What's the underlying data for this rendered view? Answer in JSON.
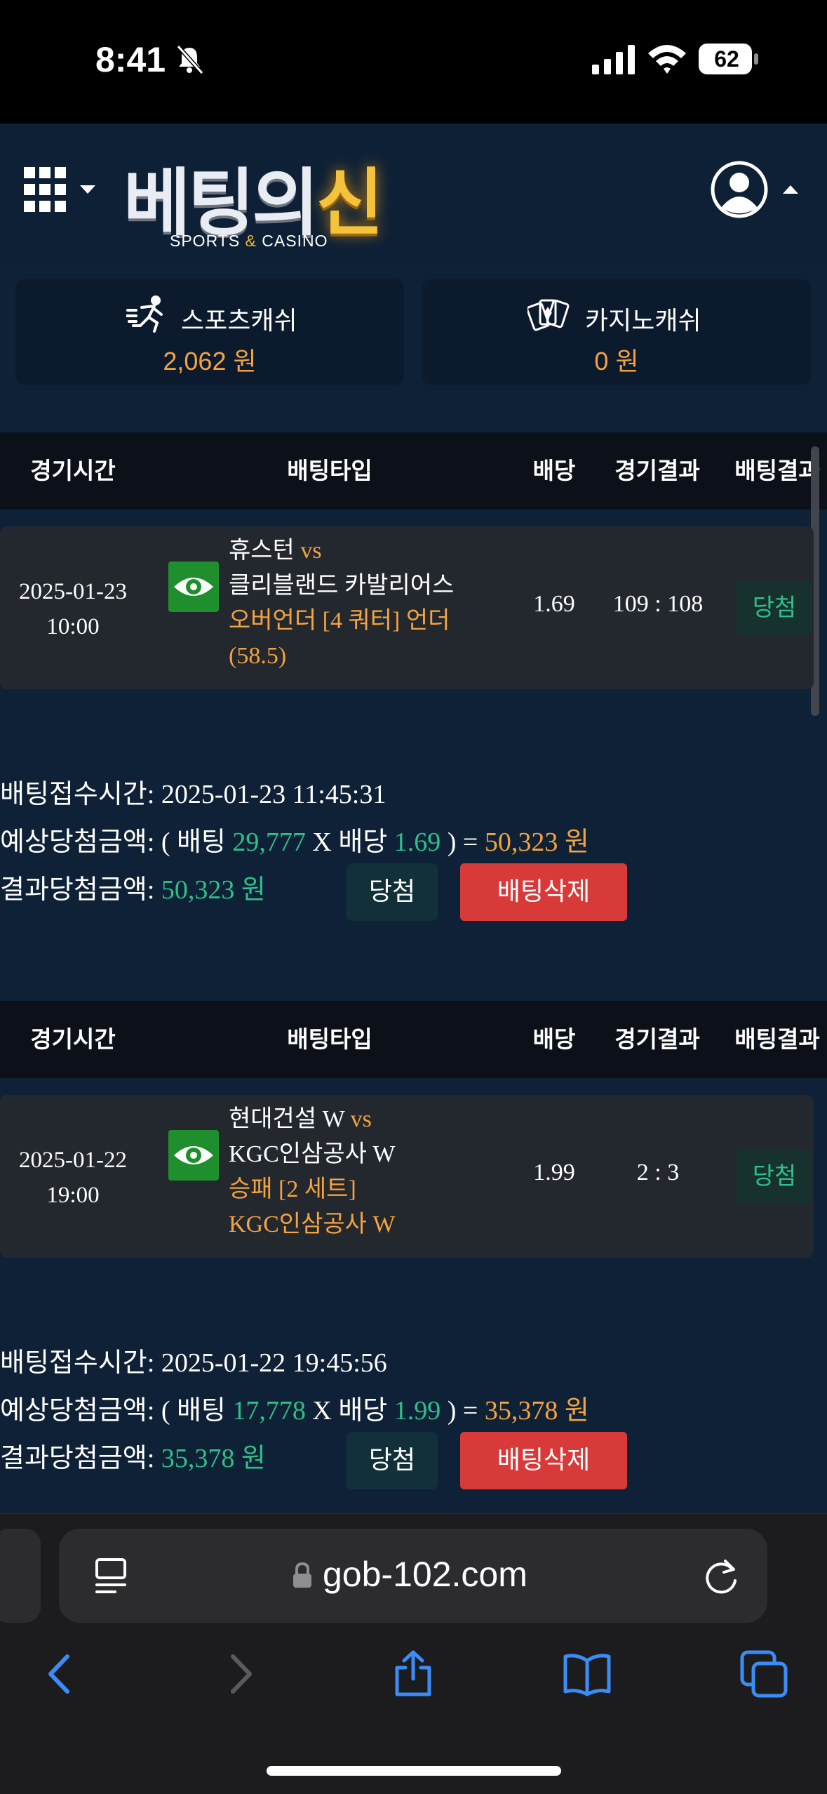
{
  "status_bar": {
    "time": "8:41",
    "battery": "62"
  },
  "header": {
    "logo_title_part1": "베팅의",
    "logo_title_part2": "신",
    "logo_sub_part1": "SPORTS ",
    "logo_sub_amp": "&",
    "logo_sub_part2": " CASINO"
  },
  "balances": {
    "sports": {
      "label": "스포츠캐쉬",
      "amount": "2,062 원"
    },
    "casino": {
      "label": "카지노캐쉬",
      "amount": "0 원"
    }
  },
  "table_headers": {
    "time": "경기시간",
    "type": "배팅타입",
    "odds": "배당",
    "result": "경기결과",
    "bet_result": "배팅결과"
  },
  "bets": [
    {
      "date": "2025-01-23",
      "time": "10:00",
      "home": "휴스턴",
      "vs": "vs",
      "away": "클리블랜드 카발리어스",
      "market": "오버언더 [4 쿼터] 언더",
      "pick": "(58.5)",
      "odds": "1.69",
      "score": "109 : 108",
      "status": "당첨",
      "summary": {
        "received_label": "배팅접수시간: ",
        "received": "2025-01-23 11:45:31",
        "expected_label": "예상당첨금액: ( 배팅 ",
        "stake": "29,777",
        "mult_label": " X 배당 ",
        "mult": "1.69",
        "eq": " ) = ",
        "expected": "50,323 원",
        "result_label": "결과당첨금액: ",
        "result": "50,323 원",
        "win_button": "당첨",
        "delete_button": "배팅삭제"
      }
    },
    {
      "date": "2025-01-22",
      "time": "19:00",
      "home": "현대건설 W",
      "vs": "vs",
      "away": "KGC인삼공사 W",
      "market": "승패 [2 세트]",
      "pick": "KGC인삼공사 W",
      "odds": "1.99",
      "score": "2 : 3",
      "status": "당첨",
      "summary": {
        "received_label": "배팅접수시간: ",
        "received": "2025-01-22 19:45:56",
        "expected_label": "예상당첨금액: ( 배팅 ",
        "stake": "17,778",
        "mult_label": " X 배당 ",
        "mult": "1.99",
        "eq": " ) = ",
        "expected": "35,378 원",
        "result_label": "결과당첨금액: ",
        "result": "35,378 원",
        "win_button": "당첨",
        "delete_button": "배팅삭제"
      }
    }
  ],
  "browser": {
    "url": "gob-102.com"
  },
  "colors": {
    "accent_orange": "#f5a340",
    "accent_teal": "#2fbf8a",
    "delete_red": "#d83a3a",
    "eye_green": "#1e8f2c"
  }
}
